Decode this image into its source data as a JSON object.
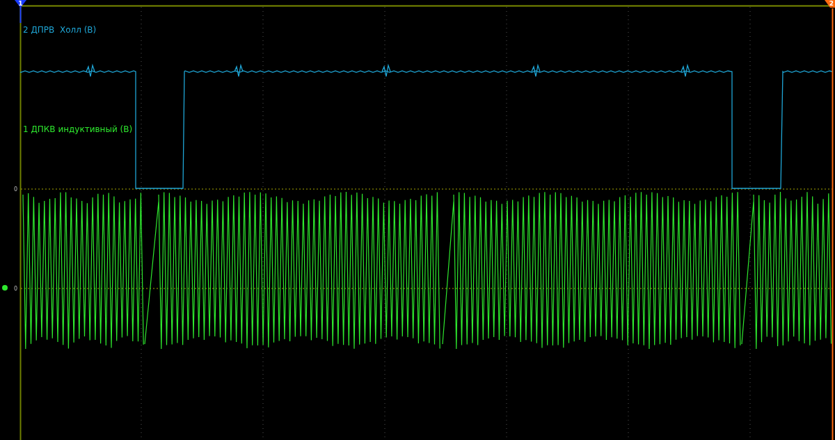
{
  "cursors": [
    {
      "label": "1",
      "color": "#1a3cff"
    },
    {
      "label": "2",
      "color": "#ff6a10"
    }
  ],
  "channels": [
    {
      "label": "2 ДПРВ  Холл (В)",
      "color": "#1fa6d6",
      "zero_label": "0"
    },
    {
      "label": "1 ДПКВ индуктивный (В)",
      "color": "#2ee82e",
      "zero_label": "0"
    }
  ]
}
